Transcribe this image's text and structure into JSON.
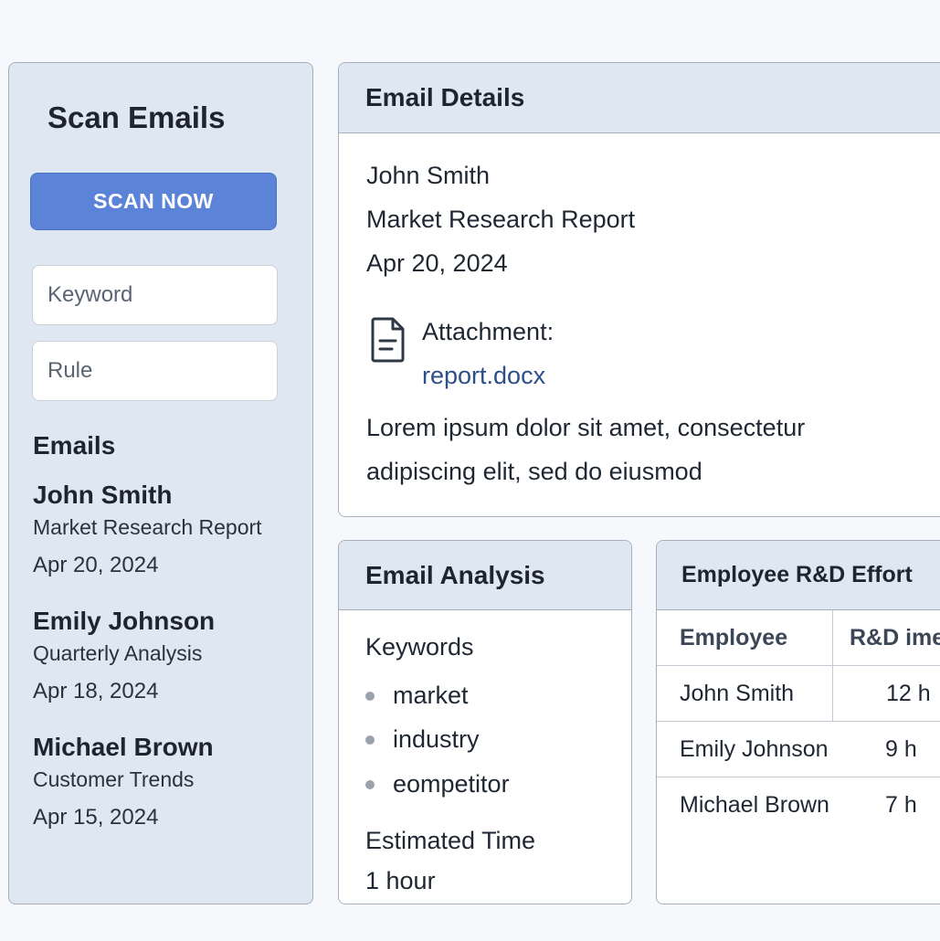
{
  "sidebar": {
    "title": "Scan Emails",
    "scan_button": "SCAN NOW",
    "keyword_placeholder": "Keyword",
    "rule_placeholder": "Rule",
    "emails_heading": "Emails",
    "emails": [
      {
        "name": "John Smith",
        "subject": "Market Research Report",
        "date": "Apr 20, 2024"
      },
      {
        "name": "Emily Johnson",
        "subject": "Quarterly Analysis",
        "date": "Apr 18, 2024"
      },
      {
        "name": "Michael Brown",
        "subject": "Customer Trends",
        "date": "Apr 15, 2024"
      }
    ]
  },
  "details": {
    "title": "Email Details",
    "sender": "John Smith",
    "subject": "Market Research Report",
    "date": "Apr 20, 2024",
    "attachment_label": "Attachment:",
    "attachment_file": "report.docx",
    "body_line1": "Lorem ipsum dolor sit amet, consectetur",
    "body_line2": "adipiscing elit, sed do eiusmod"
  },
  "analysis": {
    "title": "Email Analysis",
    "keywords_heading": "Keywords",
    "keywords": [
      "market",
      "industry",
      "eompetitor"
    ],
    "time_heading": "Estimated Time",
    "time_value": "1 hour"
  },
  "effort": {
    "title": "Employee R&D Effort",
    "columns": [
      "Employee",
      "R&D ime"
    ],
    "rows": [
      {
        "employee": "John Smith",
        "time": "12 h"
      },
      {
        "employee": "Emily Johnson",
        "time": "9 h"
      },
      {
        "employee": "Michael Brown",
        "time": "7 h"
      }
    ]
  },
  "icons": {
    "attachment": "document-icon"
  },
  "colors": {
    "accent": "#5b84d8",
    "panel_header": "#dfe7f3",
    "link": "#2c4f87"
  }
}
